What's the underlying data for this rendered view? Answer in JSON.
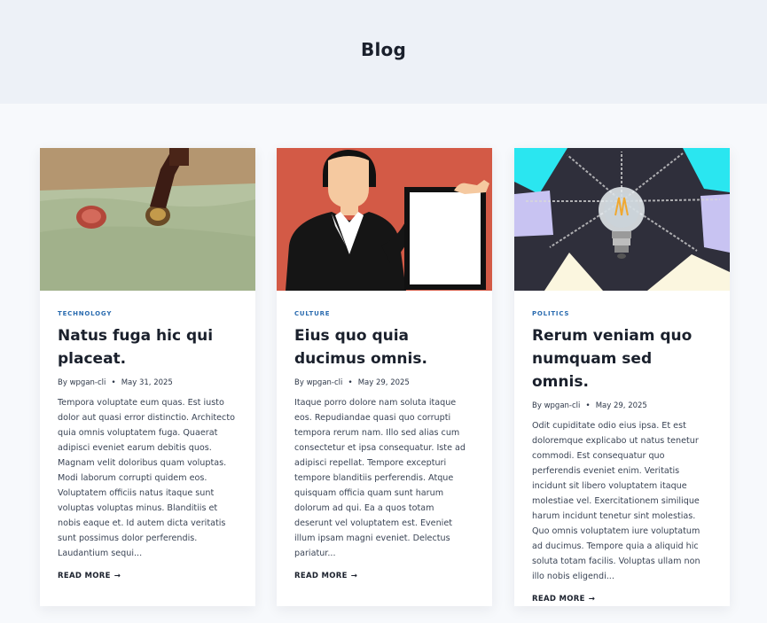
{
  "page": {
    "title": "Blog"
  },
  "posts": [
    {
      "category": "TECHNOLOGY",
      "title": "Natus fuga hic qui placeat.",
      "author_prefix": "By",
      "author": "wpgan-cli",
      "separator": "•",
      "date": "May 31, 2025",
      "excerpt": "Tempora voluptate eum quas. Est iusto dolor aut quasi error distinctio. Architecto quia omnis voluptatem fuga. Quaerat adipisci eveniet earum debitis quos. Magnam velit doloribus quam voluptas. Modi laborum corrupti quidem eos. Voluptatem officiis natus itaque sunt voluptas voluptas minus. Blanditiis et nobis eaque et. Id autem dicta veritatis sunt possimus dolor perferendis. Laudantium sequi...",
      "read_more": "READ MORE",
      "read_more_arrow": "→",
      "image": "wax-seal-stamp-photo"
    },
    {
      "category": "CULTURE",
      "title": "Eius quo quia ducimus omnis.",
      "author_prefix": "By",
      "author": "wpgan-cli",
      "separator": "•",
      "date": "May 29, 2025",
      "excerpt": "Itaque porro dolore nam soluta itaque eos. Repudiandae quasi quo corrupti tempora rerum nam. Illo sed alias cum consectetur et ipsa consequatur. Iste ad adipisci repellat. Tempore excepturi tempore blanditiis perferendis. Atque quisquam officia quam sunt harum dolorum ad qui. Ea a quos totam deserunt vel voluptatem est. Eveniet illum ipsam magni eveniet. Delectus pariatur...",
      "read_more": "READ MORE",
      "read_more_arrow": "→",
      "image": "businesswoman-holding-board-illustration"
    },
    {
      "category": "POLITICS",
      "title": "Rerum veniam quo numquam sed omnis.",
      "author_prefix": "By",
      "author": "wpgan-cli",
      "separator": "•",
      "date": "May 29, 2025",
      "excerpt": "Odit cupiditate odio eius ipsa. Et est doloremque explicabo ut natus tenetur commodi. Est consequatur quo perferendis eveniet enim. Veritatis incidunt sit libero voluptatem itaque molestiae vel. Exercitationem similique harum incidunt tenetur sint molestias. Quo omnis voluptatem iure voluptatum ad ducimus. Tempore quia a aliquid hic soluta totam facilis. Voluptas ullam non illo nobis eligendi...",
      "read_more": "READ MORE",
      "read_more_arrow": "→",
      "image": "light-bulb-chalkboard-photo"
    }
  ],
  "colors": {
    "hero_bg": "#edf1f7",
    "page_bg": "#f7f9fc",
    "category": "#2b6cb0",
    "heading": "#1a202c",
    "body_text": "#3a4455"
  }
}
